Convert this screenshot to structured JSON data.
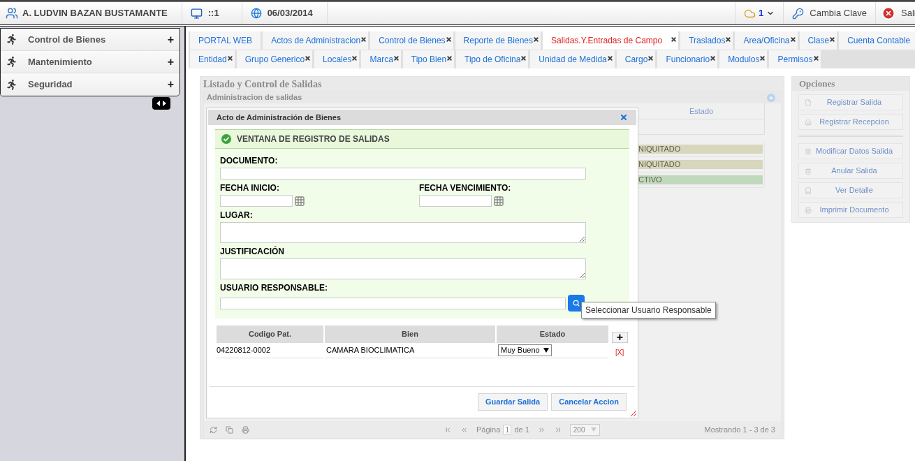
{
  "header": {
    "user": "A. LUDVIN BAZAN BUSTAMANTE",
    "terminal": "::1",
    "date": "06/03/2014",
    "notifications": "1",
    "change_password": "Cambia Clave",
    "exit": "Sali"
  },
  "sidebar": {
    "items": [
      {
        "label": "Control de Bienes",
        "toggle": "+"
      },
      {
        "label": "Mantenimiento",
        "toggle": "+"
      },
      {
        "label": "Seguridad",
        "toggle": "+"
      }
    ]
  },
  "tab_rows": [
    {
      "tabs": [
        {
          "label": "PORTAL WEB",
          "selected": false,
          "closable": false
        },
        {
          "label": "Actos de Administracion",
          "selected": false,
          "closable": true
        },
        {
          "label": "Control de Bienes",
          "selected": false,
          "closable": true
        },
        {
          "label": "Reporte de Bienes",
          "selected": false,
          "closable": true
        },
        {
          "label": "Salidas.Y.Entradas de Campo",
          "selected": true,
          "closable": true
        },
        {
          "label": "Traslados",
          "selected": false,
          "closable": true
        },
        {
          "label": "Area/Oficina",
          "selected": false,
          "closable": true
        },
        {
          "label": "Clase",
          "selected": false,
          "closable": true
        },
        {
          "label": "Cuenta Contable",
          "selected": false,
          "closable": false
        }
      ]
    },
    {
      "tabs": [
        {
          "label": "Entidad",
          "selected": false,
          "closable": true
        },
        {
          "label": "Grupo Generico",
          "selected": false,
          "closable": true
        },
        {
          "label": "Locales",
          "selected": false,
          "closable": true
        },
        {
          "label": "Marca",
          "selected": false,
          "closable": true
        },
        {
          "label": "Tipo Bien",
          "selected": false,
          "closable": true
        },
        {
          "label": "Tipo de Oficina",
          "selected": false,
          "closable": true
        },
        {
          "label": "Unidad de Medida",
          "selected": false,
          "closable": true
        },
        {
          "label": "Cargo",
          "selected": false,
          "closable": true
        },
        {
          "label": "Funcionario",
          "selected": false,
          "closable": true
        },
        {
          "label": "Modulos",
          "selected": false,
          "closable": true
        },
        {
          "label": "Permisos",
          "selected": false,
          "closable": true
        }
      ]
    }
  ],
  "listing": {
    "title": "Listado y Control de Salidas",
    "grid_caption": "Administracion de salidas",
    "column": "Estado",
    "rows": [
      {
        "estado": "NIQUITADO",
        "color": "#d8d6bc"
      },
      {
        "estado": "NIQUITADO",
        "color": "#d8d6bc"
      },
      {
        "estado": "CTIVO",
        "color": "#c0d8bc"
      }
    ],
    "pager": {
      "page_label": "Página",
      "page": "1",
      "of": "de 1",
      "page_size": "200",
      "summary": "Mostrando 1 - 3 de 3"
    }
  },
  "options": {
    "title": "Opciones",
    "groups": [
      [
        "Registrar Salida",
        "Registrar Recepcion"
      ],
      [
        "Modificar Datos Salida",
        "Anular Salida",
        "Ver Detalle",
        "Imprimir Documento"
      ]
    ]
  },
  "dialog": {
    "title": "Acto de Administración de Bienes",
    "heading": "VENTANA DE REGISTRO DE SALIDAS",
    "field_rows": [
      {
        "fields": [
          {
            "label": "DOCUMENTO:",
            "kind": "text"
          }
        ]
      },
      {
        "fields": [
          {
            "label": "FECHA INICIO:",
            "kind": "date"
          },
          {
            "label": "FECHA VENCIMIENTO:",
            "kind": "date"
          }
        ]
      },
      {
        "fields": [
          {
            "label": "LUGAR:",
            "kind": "textarea"
          }
        ]
      },
      {
        "fields": [
          {
            "label": "JUSTIFICACIÓN",
            "kind": "textarea"
          }
        ]
      },
      {
        "fields": [
          {
            "label": "USUARIO RESPONSABLE:",
            "kind": "lookup"
          }
        ]
      }
    ],
    "tooltip": "Seleccionar Usuario Responsable",
    "table": {
      "columns": [
        "Codigo Pat.",
        "Bien",
        "Estado"
      ],
      "add": "+",
      "rows": [
        {
          "code": "04220812-0002",
          "item": "CAMARA BIOCLIMATICA",
          "estado": "Muy Bueno",
          "remove": "[X]"
        }
      ]
    },
    "buttons": [
      "Guardar Salida",
      "Cancelar Accion"
    ]
  }
}
